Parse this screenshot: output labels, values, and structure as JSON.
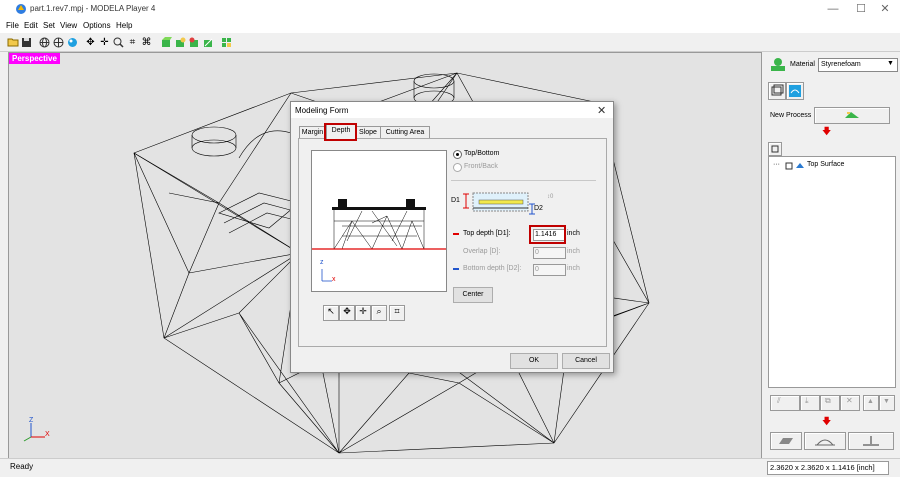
{
  "window": {
    "title": "part.1.rev7.mpj - MODELA Player 4",
    "minimize": "—",
    "maximize": "☐",
    "close": "✕"
  },
  "menu": [
    "File",
    "Edit",
    "Set",
    "View",
    "Options",
    "Help"
  ],
  "viewport": {
    "label": "Perspective"
  },
  "dialog": {
    "title": "Modeling Form",
    "close": "✕",
    "tabs": [
      "Margin",
      "Depth",
      "Slope",
      "Cutting Area"
    ],
    "active_tab": "Depth",
    "radio_top": "Top/Bottom",
    "radio_front": "Front/Back",
    "d1": "D1",
    "d2": "D2",
    "top_depth_label": "Top depth [D1]:",
    "top_depth_value": "1.1416",
    "top_depth_unit": "inch",
    "overlap_label": "Overlap [D]:",
    "overlap_value": "0",
    "overlap_unit": "inch",
    "bottom_depth_label": "Bottom depth [D2]:",
    "bottom_depth_value": "0",
    "bottom_depth_unit": "inch",
    "center_button": "Center",
    "ok_button": "OK",
    "cancel_button": "Cancel",
    "axis_z": "z",
    "axis_x": "x"
  },
  "right_panel": {
    "material_label": "Material",
    "material_value": "Styrenefoam",
    "new_process": "New Process",
    "tree_item": "Top Surface"
  },
  "status": {
    "left": "Ready",
    "right": "2.3620 x 2.3620 x 1.1416 [inch]"
  },
  "colors": {
    "accent_red": "#c00000",
    "perspective_bg": "#ff00ff",
    "red_line": "#e00000",
    "blue_mark": "#2255cc"
  }
}
